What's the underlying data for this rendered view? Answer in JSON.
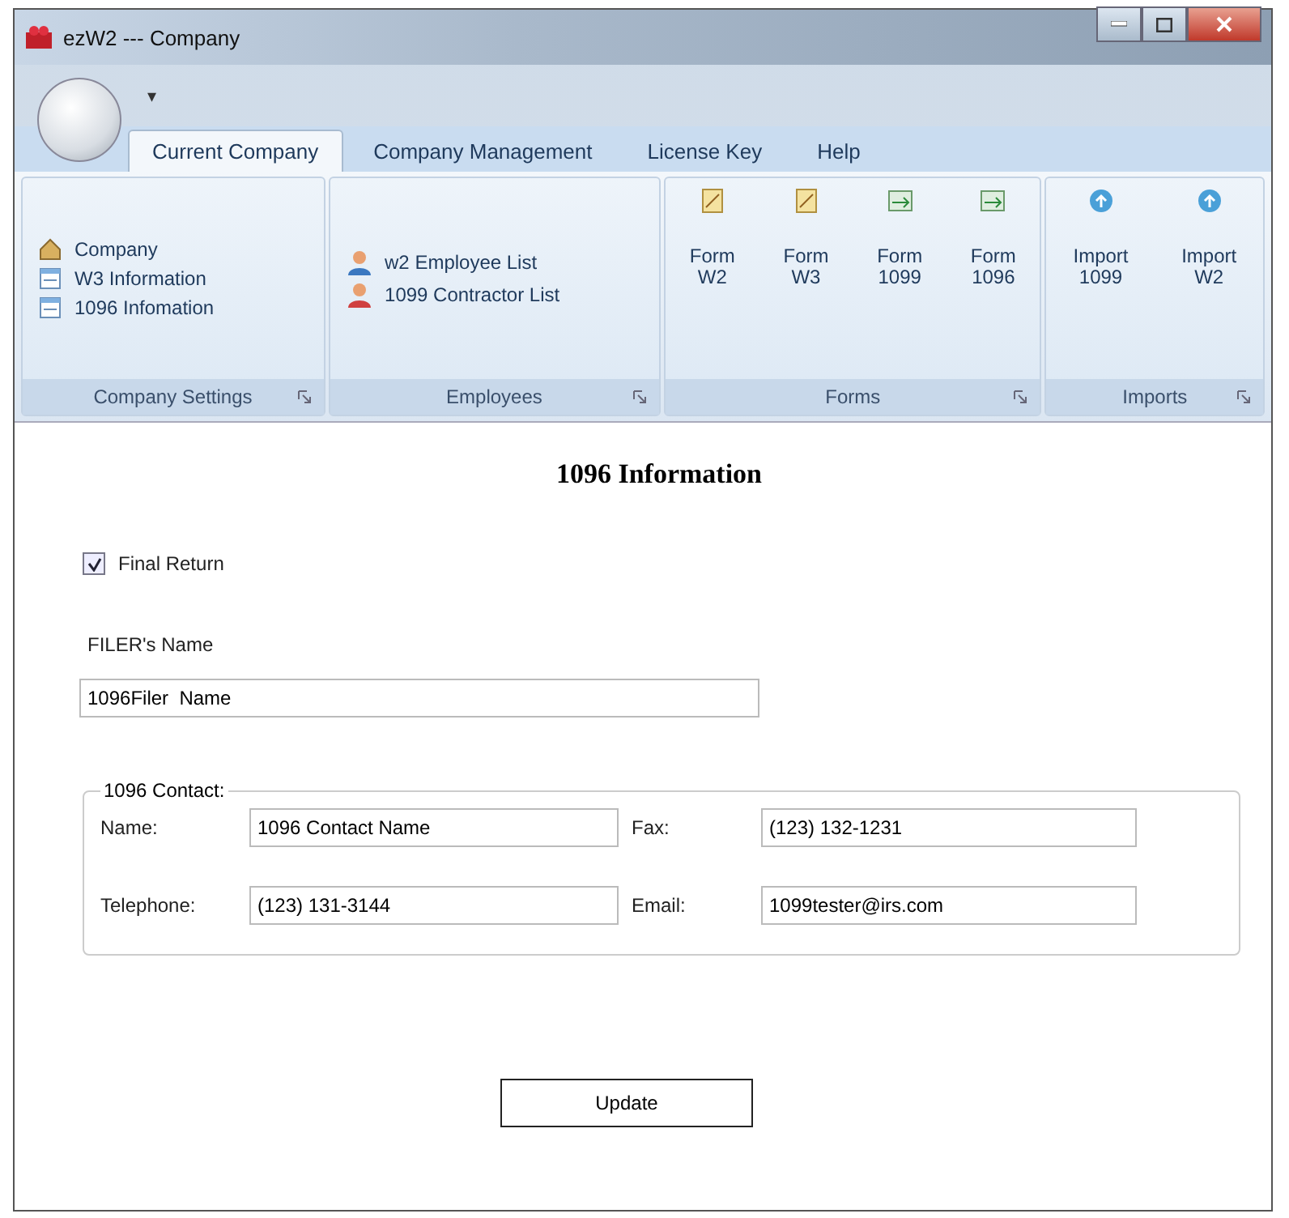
{
  "window": {
    "title": "ezW2 --- Company",
    "quick_access": "▾"
  },
  "tabs": [
    {
      "label": "Current Company",
      "selected": true
    },
    {
      "label": "Company Management",
      "selected": false
    },
    {
      "label": "License Key",
      "selected": false
    },
    {
      "label": "Help",
      "selected": false
    }
  ],
  "ribbon_groups": [
    {
      "title": "Company Settings",
      "kind": "list",
      "items": [
        {
          "label": "Company",
          "kind": "house"
        },
        {
          "label": "W3 Information",
          "kind": "form"
        },
        {
          "label": "1096 Infomation",
          "kind": "form"
        }
      ]
    },
    {
      "title": "Employees",
      "kind": "list",
      "items": [
        {
          "label": "w2 Employee List",
          "kind": "employee"
        },
        {
          "label": "1099 Contractor List",
          "kind": "contractor"
        }
      ]
    },
    {
      "title": "Forms",
      "kind": "large",
      "items": [
        {
          "label": "Form\nW2",
          "kind": "document"
        },
        {
          "label": "Form\nW3",
          "kind": "document"
        },
        {
          "label": "Form\n1099",
          "kind": "transfer"
        },
        {
          "label": "Form\n1096",
          "kind": "transfer"
        }
      ]
    },
    {
      "title": "Imports",
      "kind": "large",
      "items": [
        {
          "label": "Import\n1099",
          "kind": "upload"
        },
        {
          "label": "Import\nW2",
          "kind": "upload"
        }
      ]
    }
  ],
  "form": {
    "title": "1096 Information",
    "final_return": {
      "label": "Final Return",
      "checked": true
    },
    "filer_label": "FILER's Name",
    "filer_value": "1096Filer  Name",
    "contact": {
      "legend": "1096 Contact:",
      "fields": [
        {
          "label": "Name:",
          "value": "1096 Contact Name"
        },
        {
          "label": "Fax:",
          "value": "(123) 132-1231"
        },
        {
          "label": "Telephone:",
          "value": "(123) 131-3144"
        },
        {
          "label": "Email:",
          "value": "1099tester@irs.com"
        }
      ]
    },
    "button": "Update"
  }
}
